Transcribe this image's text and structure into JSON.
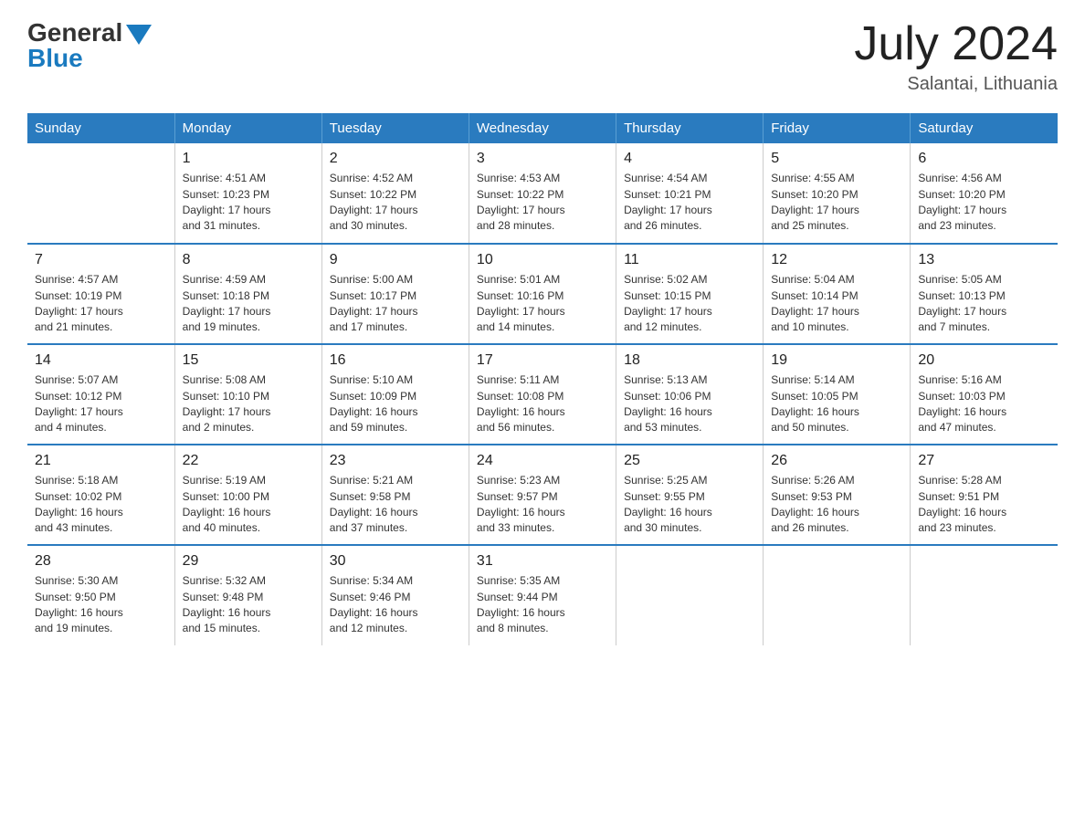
{
  "header": {
    "logo_general": "General",
    "logo_blue": "Blue",
    "month_title": "July 2024",
    "location": "Salantai, Lithuania"
  },
  "weekdays": [
    "Sunday",
    "Monday",
    "Tuesday",
    "Wednesday",
    "Thursday",
    "Friday",
    "Saturday"
  ],
  "weeks": [
    [
      {
        "day": "",
        "info": ""
      },
      {
        "day": "1",
        "info": "Sunrise: 4:51 AM\nSunset: 10:23 PM\nDaylight: 17 hours\nand 31 minutes."
      },
      {
        "day": "2",
        "info": "Sunrise: 4:52 AM\nSunset: 10:22 PM\nDaylight: 17 hours\nand 30 minutes."
      },
      {
        "day": "3",
        "info": "Sunrise: 4:53 AM\nSunset: 10:22 PM\nDaylight: 17 hours\nand 28 minutes."
      },
      {
        "day": "4",
        "info": "Sunrise: 4:54 AM\nSunset: 10:21 PM\nDaylight: 17 hours\nand 26 minutes."
      },
      {
        "day": "5",
        "info": "Sunrise: 4:55 AM\nSunset: 10:20 PM\nDaylight: 17 hours\nand 25 minutes."
      },
      {
        "day": "6",
        "info": "Sunrise: 4:56 AM\nSunset: 10:20 PM\nDaylight: 17 hours\nand 23 minutes."
      }
    ],
    [
      {
        "day": "7",
        "info": "Sunrise: 4:57 AM\nSunset: 10:19 PM\nDaylight: 17 hours\nand 21 minutes."
      },
      {
        "day": "8",
        "info": "Sunrise: 4:59 AM\nSunset: 10:18 PM\nDaylight: 17 hours\nand 19 minutes."
      },
      {
        "day": "9",
        "info": "Sunrise: 5:00 AM\nSunset: 10:17 PM\nDaylight: 17 hours\nand 17 minutes."
      },
      {
        "day": "10",
        "info": "Sunrise: 5:01 AM\nSunset: 10:16 PM\nDaylight: 17 hours\nand 14 minutes."
      },
      {
        "day": "11",
        "info": "Sunrise: 5:02 AM\nSunset: 10:15 PM\nDaylight: 17 hours\nand 12 minutes."
      },
      {
        "day": "12",
        "info": "Sunrise: 5:04 AM\nSunset: 10:14 PM\nDaylight: 17 hours\nand 10 minutes."
      },
      {
        "day": "13",
        "info": "Sunrise: 5:05 AM\nSunset: 10:13 PM\nDaylight: 17 hours\nand 7 minutes."
      }
    ],
    [
      {
        "day": "14",
        "info": "Sunrise: 5:07 AM\nSunset: 10:12 PM\nDaylight: 17 hours\nand 4 minutes."
      },
      {
        "day": "15",
        "info": "Sunrise: 5:08 AM\nSunset: 10:10 PM\nDaylight: 17 hours\nand 2 minutes."
      },
      {
        "day": "16",
        "info": "Sunrise: 5:10 AM\nSunset: 10:09 PM\nDaylight: 16 hours\nand 59 minutes."
      },
      {
        "day": "17",
        "info": "Sunrise: 5:11 AM\nSunset: 10:08 PM\nDaylight: 16 hours\nand 56 minutes."
      },
      {
        "day": "18",
        "info": "Sunrise: 5:13 AM\nSunset: 10:06 PM\nDaylight: 16 hours\nand 53 minutes."
      },
      {
        "day": "19",
        "info": "Sunrise: 5:14 AM\nSunset: 10:05 PM\nDaylight: 16 hours\nand 50 minutes."
      },
      {
        "day": "20",
        "info": "Sunrise: 5:16 AM\nSunset: 10:03 PM\nDaylight: 16 hours\nand 47 minutes."
      }
    ],
    [
      {
        "day": "21",
        "info": "Sunrise: 5:18 AM\nSunset: 10:02 PM\nDaylight: 16 hours\nand 43 minutes."
      },
      {
        "day": "22",
        "info": "Sunrise: 5:19 AM\nSunset: 10:00 PM\nDaylight: 16 hours\nand 40 minutes."
      },
      {
        "day": "23",
        "info": "Sunrise: 5:21 AM\nSunset: 9:58 PM\nDaylight: 16 hours\nand 37 minutes."
      },
      {
        "day": "24",
        "info": "Sunrise: 5:23 AM\nSunset: 9:57 PM\nDaylight: 16 hours\nand 33 minutes."
      },
      {
        "day": "25",
        "info": "Sunrise: 5:25 AM\nSunset: 9:55 PM\nDaylight: 16 hours\nand 30 minutes."
      },
      {
        "day": "26",
        "info": "Sunrise: 5:26 AM\nSunset: 9:53 PM\nDaylight: 16 hours\nand 26 minutes."
      },
      {
        "day": "27",
        "info": "Sunrise: 5:28 AM\nSunset: 9:51 PM\nDaylight: 16 hours\nand 23 minutes."
      }
    ],
    [
      {
        "day": "28",
        "info": "Sunrise: 5:30 AM\nSunset: 9:50 PM\nDaylight: 16 hours\nand 19 minutes."
      },
      {
        "day": "29",
        "info": "Sunrise: 5:32 AM\nSunset: 9:48 PM\nDaylight: 16 hours\nand 15 minutes."
      },
      {
        "day": "30",
        "info": "Sunrise: 5:34 AM\nSunset: 9:46 PM\nDaylight: 16 hours\nand 12 minutes."
      },
      {
        "day": "31",
        "info": "Sunrise: 5:35 AM\nSunset: 9:44 PM\nDaylight: 16 hours\nand 8 minutes."
      },
      {
        "day": "",
        "info": ""
      },
      {
        "day": "",
        "info": ""
      },
      {
        "day": "",
        "info": ""
      }
    ]
  ]
}
